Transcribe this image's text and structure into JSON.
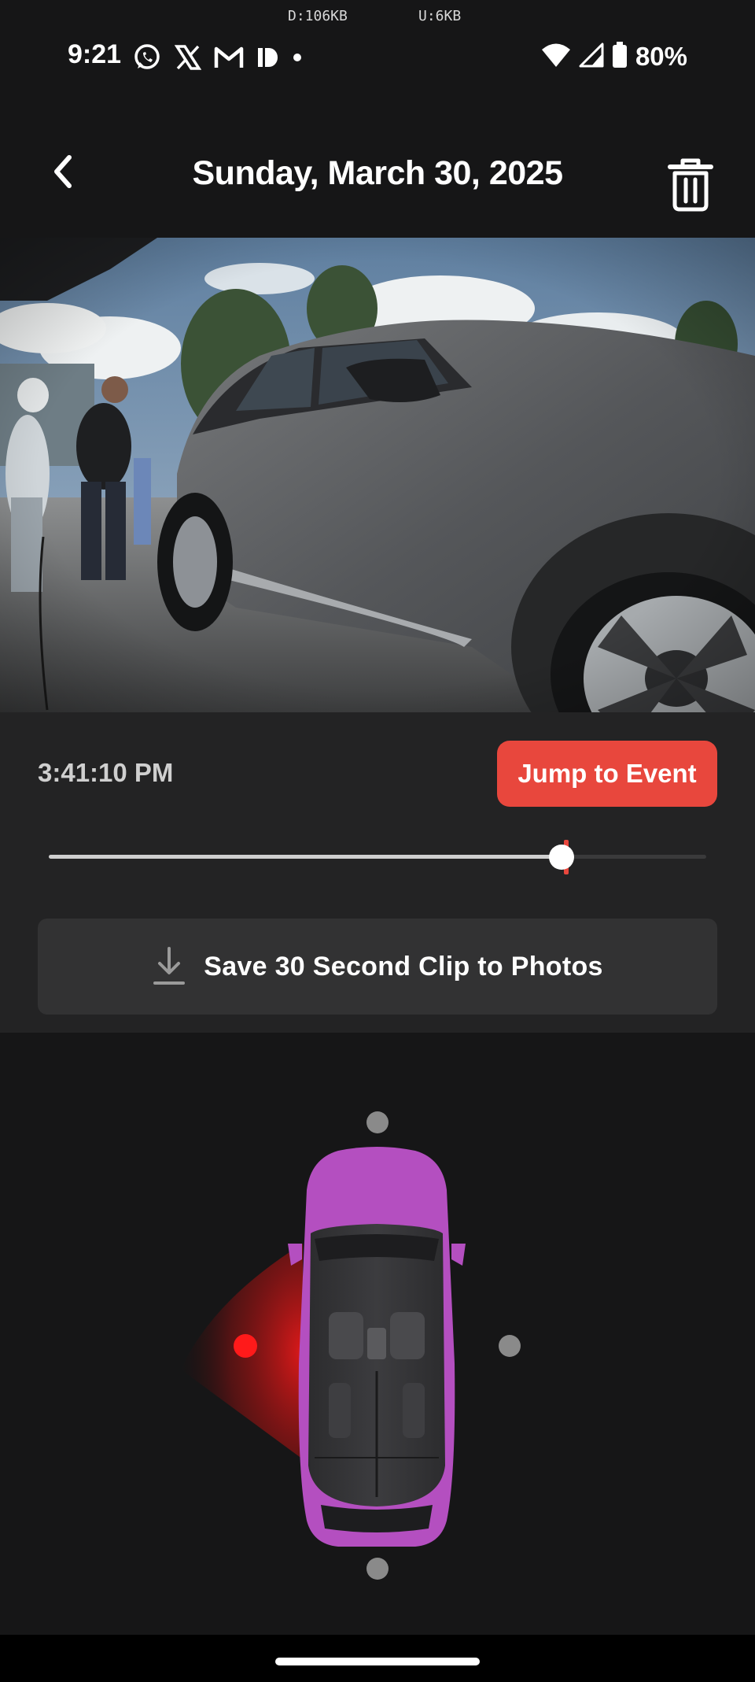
{
  "status_bar": {
    "download_speed": "D:106KB",
    "upload_speed": "U:6KB",
    "time": "9:21",
    "battery": "80%",
    "notification_icons": [
      "whatsapp-icon",
      "x-icon",
      "gmail-icon",
      "app-icon",
      "dot-icon"
    ],
    "right_icons": [
      "wifi-icon",
      "signal-icon",
      "battery-icon"
    ]
  },
  "header": {
    "title": "Sunday, March 30, 2025",
    "back_icon": "chevron-left-icon",
    "delete_icon": "trash-icon"
  },
  "playback": {
    "timestamp": "3:41:10 PM",
    "jump_label": "Jump to Event",
    "progress": 0.78,
    "event_position": 0.787
  },
  "save": {
    "label": "Save 30 Second Clip to Photos",
    "icon": "download-icon"
  },
  "camera_diagram": {
    "active_camera": "left",
    "camera_count": 4
  },
  "colors": {
    "accent": "#e8473d",
    "background": "#161617",
    "panel": "#232324",
    "car": "#b44fc0",
    "active_camera": "#ff1a1a",
    "inactive_camera": "#8a8a8a"
  }
}
